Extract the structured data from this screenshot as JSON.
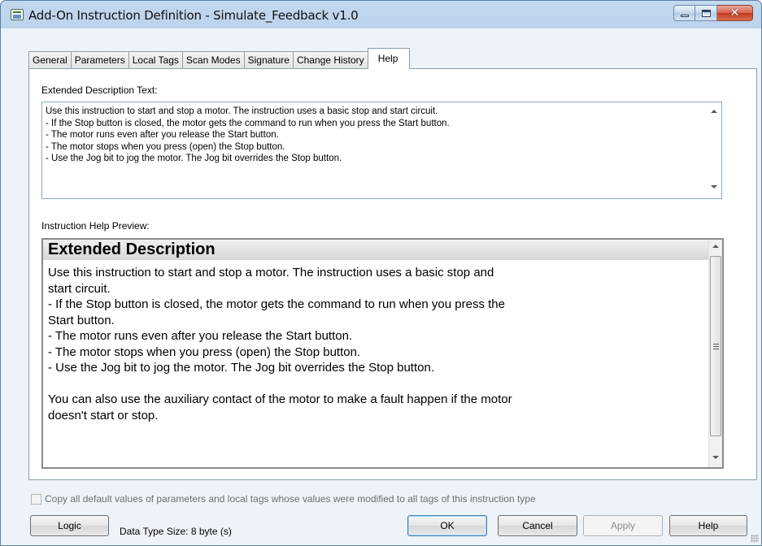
{
  "window": {
    "title": "Add-On Instruction Definition - Simulate_Feedback v1.0",
    "close_glyph": "✕"
  },
  "tabs": [
    {
      "label": "General"
    },
    {
      "label": "Parameters"
    },
    {
      "label": "Local Tags"
    },
    {
      "label": "Scan Modes"
    },
    {
      "label": "Signature"
    },
    {
      "label": "Change History"
    },
    {
      "label": "Help",
      "active": true
    }
  ],
  "extended": {
    "label": "Extended Description Text:",
    "lines": [
      "Use this instruction to start and stop a motor. The instruction uses a basic stop and start circuit.",
      "- If the Stop button is closed, the motor gets the command to run when you press the Start button.",
      "- The motor runs even after you release the Start button.",
      "- The motor stops when you press (open) the Stop button.",
      "- Use the Jog bit to jog the motor. The Jog bit overrides the Stop button."
    ]
  },
  "preview": {
    "label": "Instruction Help Preview:",
    "heading": "Extended Description",
    "lines": [
      "Use this instruction to start and stop a motor. The instruction uses a basic stop and",
      "start circuit.",
      "- If the Stop button is closed, the motor gets the command to run when you press the",
      "Start button.",
      "- The motor runs even after you release the Start button.",
      "- The motor stops when you press (open) the Stop button.",
      "- Use the Jog bit to jog the motor. The Jog bit overrides the Stop button.",
      "",
      "You can also use the auxiliary contact of the motor to make a fault happen if the motor",
      "doesn't start or stop."
    ]
  },
  "footer": {
    "copy_label": "Copy all default values of parameters and local tags whose values were modified to all tags of this instruction type",
    "copy_checked": false,
    "logic_label": "Logic",
    "data_type_size": "Data Type Size: 8 byte (s)",
    "ok_label": "OK",
    "cancel_label": "Cancel",
    "apply_label": "Apply",
    "help_label": "Help"
  },
  "colors": {
    "title_bar": "#bcd3ec",
    "close_button": "#c2381e",
    "default_button_border": "#3c7fb1"
  }
}
